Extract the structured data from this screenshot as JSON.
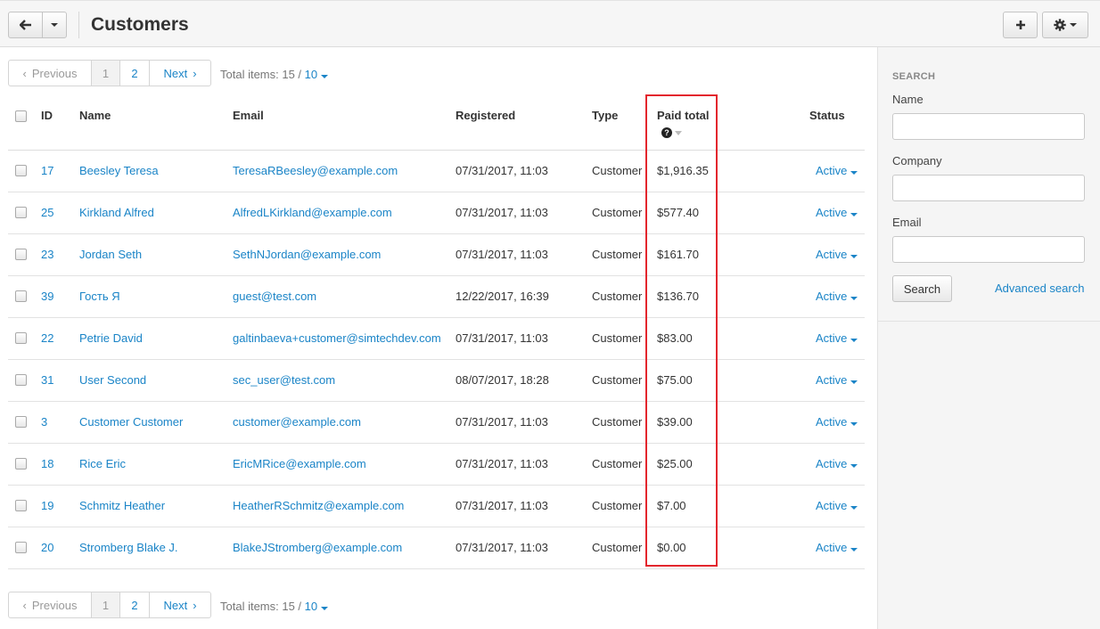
{
  "header": {
    "title": "Customers"
  },
  "pagination": {
    "prev_label": "Previous",
    "pages": [
      "1",
      "2"
    ],
    "next_label": "Next",
    "total_prefix": "Total items: 15 / ",
    "per_page": "10"
  },
  "table": {
    "headers": {
      "id": "ID",
      "name": "Name",
      "email": "Email",
      "registered": "Registered",
      "type": "Type",
      "paid_total": "Paid total",
      "status": "Status"
    },
    "rows": [
      {
        "id": "17",
        "name": "Beesley Teresa",
        "email": "TeresaRBeesley@example.com",
        "registered": "07/31/2017, 11:03",
        "type": "Customer",
        "paid_total": "$1,916.35",
        "status": "Active"
      },
      {
        "id": "25",
        "name": "Kirkland Alfred",
        "email": "AlfredLKirkland@example.com",
        "registered": "07/31/2017, 11:03",
        "type": "Customer",
        "paid_total": "$577.40",
        "status": "Active"
      },
      {
        "id": "23",
        "name": "Jordan Seth",
        "email": "SethNJordan@example.com",
        "registered": "07/31/2017, 11:03",
        "type": "Customer",
        "paid_total": "$161.70",
        "status": "Active"
      },
      {
        "id": "39",
        "name": "Гость Я",
        "email": "guest@test.com",
        "registered": "12/22/2017, 16:39",
        "type": "Customer",
        "paid_total": "$136.70",
        "status": "Active"
      },
      {
        "id": "22",
        "name": "Petrie David",
        "email": "galtinbaeva+customer@simtechdev.com",
        "registered": "07/31/2017, 11:03",
        "type": "Customer",
        "paid_total": "$83.00",
        "status": "Active"
      },
      {
        "id": "31",
        "name": "User Second",
        "email": "sec_user@test.com",
        "registered": "08/07/2017, 18:28",
        "type": "Customer",
        "paid_total": "$75.00",
        "status": "Active"
      },
      {
        "id": "3",
        "name": "Customer Customer",
        "email": "customer@example.com",
        "registered": "07/31/2017, 11:03",
        "type": "Customer",
        "paid_total": "$39.00",
        "status": "Active"
      },
      {
        "id": "18",
        "name": "Rice Eric",
        "email": "EricMRice@example.com",
        "registered": "07/31/2017, 11:03",
        "type": "Customer",
        "paid_total": "$25.00",
        "status": "Active"
      },
      {
        "id": "19",
        "name": "Schmitz Heather",
        "email": "HeatherRSchmitz@example.com",
        "registered": "07/31/2017, 11:03",
        "type": "Customer",
        "paid_total": "$7.00",
        "status": "Active"
      },
      {
        "id": "20",
        "name": "Stromberg Blake J.",
        "email": "BlakeJStromberg@example.com",
        "registered": "07/31/2017, 11:03",
        "type": "Customer",
        "paid_total": "$0.00",
        "status": "Active"
      }
    ]
  },
  "sidebar": {
    "heading": "SEARCH",
    "name_label": "Name",
    "company_label": "Company",
    "email_label": "Email",
    "search_button": "Search",
    "advanced_link": "Advanced search"
  },
  "icons": {
    "back": "arrow-left-icon",
    "add": "plus-icon",
    "settings": "gear-icon",
    "help": "question-circle-icon"
  },
  "colors": {
    "link": "#1a84c7",
    "highlight": "#e3262d"
  }
}
